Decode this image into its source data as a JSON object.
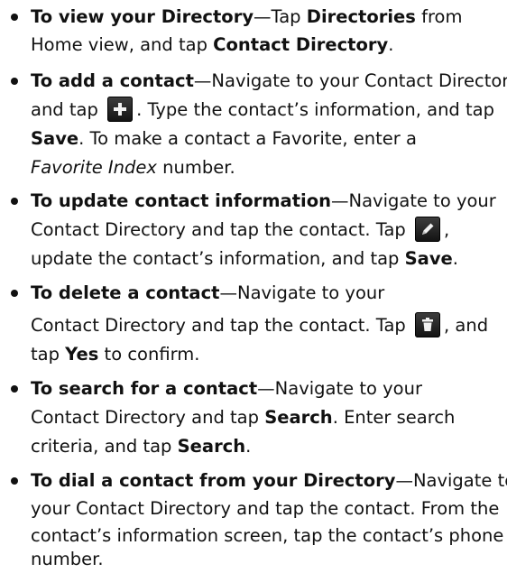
{
  "items": [
    {
      "title": "To view your Directory",
      "dash": "—",
      "l1_text": "Tap ",
      "l1_b": "Directories",
      "l1_text2": " from",
      "l2_text": "Home view, and tap ",
      "l2_b": "Contact Directory",
      "l2_end": "."
    },
    {
      "title": "To add a contact",
      "dash": "—",
      "l1_text": "Navigate to your Contact Directory",
      "l2_text": "and tap ",
      "l2_icon": "add-icon",
      "l2_text2": ". Type the contact’s information, and tap",
      "l3_b": "Save",
      "l3_text": ". To make a contact a Favorite, enter a",
      "l4_i": "Favorite Index",
      "l4_text": " number."
    },
    {
      "title": "To update contact information",
      "dash": "—",
      "l1_text": "Navigate to your",
      "l2_text": "Contact Directory and tap the contact. Tap ",
      "l2_icon": "edit-pencil-icon",
      "l2_text2": ",",
      "l3_text": "update the contact’s information, and tap ",
      "l3_b": "Save",
      "l3_end": "."
    },
    {
      "title": "To delete a contact",
      "dash": "—",
      "l1_text": "Navigate to your",
      "l2_text": "Contact Directory and tap the contact. Tap ",
      "l2_icon": "trash-icon",
      "l2_text2": ", and",
      "l3_text": "tap ",
      "l3_b": "Yes",
      "l3_text2": " to confirm."
    },
    {
      "title": "To search for a contact",
      "dash": "—",
      "l1_text": "Navigate to your",
      "l2_text": "Contact Directory and tap ",
      "l2_b": "Search",
      "l2_text2": ". Enter search",
      "l3_text": "criteria, and tap ",
      "l3_b": "Search",
      "l3_end": "."
    },
    {
      "title": "To dial a contact from your Directory",
      "dash": "—",
      "l1_text": "Navigate to",
      "l2_text": "your Contact Directory and tap the contact. From the",
      "l3_text": "contact’s information screen, tap the contact’s phone",
      "l4_text": "number."
    }
  ]
}
